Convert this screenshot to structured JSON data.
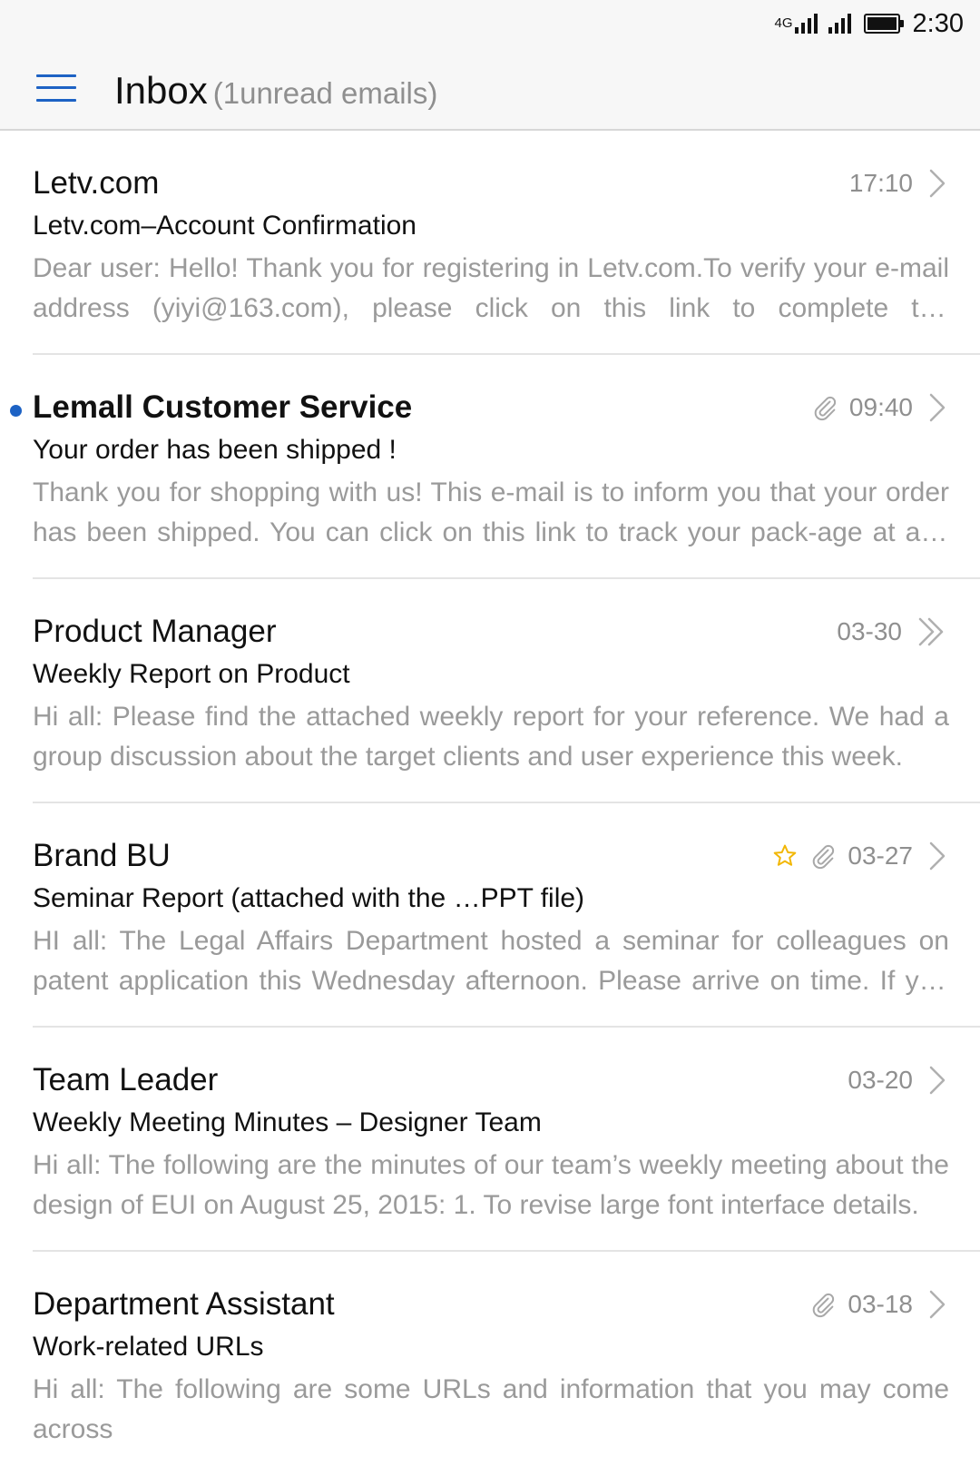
{
  "status_bar": {
    "network": "4G",
    "time": "2:30"
  },
  "header": {
    "title": "Inbox",
    "subtitle": "(1unread emails)"
  },
  "colors": {
    "accent": "#1d62c4",
    "star": "#f2b705",
    "secondary_text": "#9a9a9a"
  },
  "emails": [
    {
      "sender": "Letv.com",
      "subject": "Letv.com–Account Confirmation",
      "preview": "Dear user: Hello! Thank you for registering in Letv.com.To verify your e-mail address (yiyi@163.com), please click on this link to complete the registration process.",
      "time": "17:10",
      "unread": false,
      "has_attachment": false,
      "starred": false,
      "thread_icon": "chevron-right-icon"
    },
    {
      "sender": "Lemall Customer Service",
      "subject": "Your order has been shipped !",
      "preview": "Thank you for shopping with us! This e-mail is to inform you that your order has been shipped. You can click on this link to track your pack-age at any time.",
      "time": "09:40",
      "unread": true,
      "has_attachment": true,
      "starred": false,
      "thread_icon": "chevron-right-icon"
    },
    {
      "sender": "Product Manager",
      "subject": "Weekly Report on Product",
      "preview": "Hi all: Please find the attached weekly report for your reference. We had a group discussion about the target clients and user experience this week.",
      "time": "03-30",
      "unread": false,
      "has_attachment": false,
      "starred": false,
      "thread_icon": "double-chevron-right-icon"
    },
    {
      "sender": "Brand BU",
      "subject": "Seminar Report (attached with the …PPT file)",
      "preview": "HI all: The Legal Affairs Department hosted a seminar for colleagues on patent application this Wednesday afternoon. Please arrive on time. If you have any questions,",
      "time": "03-27",
      "unread": false,
      "has_attachment": true,
      "starred": true,
      "thread_icon": "chevron-right-icon"
    },
    {
      "sender": "Team Leader",
      "subject": "Weekly Meeting Minutes – Designer Team",
      "preview": "Hi all: The following are the minutes of our team’s weekly meeting about the design of EUI on August 25, 2015: 1. To revise large font interface details.",
      "time": "03-20",
      "unread": false,
      "has_attachment": false,
      "starred": false,
      "thread_icon": "chevron-right-icon"
    },
    {
      "sender": "Department Assistant",
      "subject": "Work-related URLs",
      "preview": "Hi all: The following are some URLs and information that you may come across",
      "time": "03-18",
      "unread": false,
      "has_attachment": true,
      "starred": false,
      "thread_icon": "chevron-right-icon"
    }
  ]
}
